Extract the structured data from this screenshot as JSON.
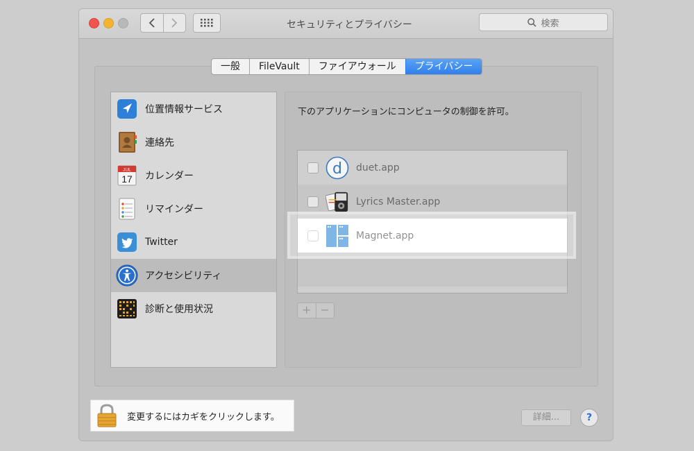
{
  "window": {
    "title": "セキュリティとプライバシー",
    "search_placeholder": "検索"
  },
  "tabs": [
    {
      "label": "一般",
      "active": false
    },
    {
      "label": "FileVault",
      "active": false
    },
    {
      "label": "ファイアウォール",
      "active": false
    },
    {
      "label": "プライバシー",
      "active": true
    }
  ],
  "sidebar": {
    "items": [
      {
        "label": "位置情報サービス",
        "icon": "location-arrow-icon",
        "selected": false
      },
      {
        "label": "連絡先",
        "icon": "contacts-book-icon",
        "selected": false
      },
      {
        "label": "カレンダー",
        "icon": "calendar-icon",
        "calendar_month": "JUL",
        "calendar_day": "17",
        "selected": false
      },
      {
        "label": "リマインダー",
        "icon": "reminders-icon",
        "selected": false
      },
      {
        "label": "Twitter",
        "icon": "twitter-bird-icon",
        "selected": false
      },
      {
        "label": "アクセシビリティ",
        "icon": "accessibility-icon",
        "selected": true
      },
      {
        "label": "診断と使用状況",
        "icon": "diagnostics-grid-icon",
        "selected": false
      }
    ]
  },
  "content": {
    "description": "下のアプリケーションにコンピュータの制御を許可。",
    "apps": [
      {
        "name": "duet.app",
        "icon": "duet-app-icon",
        "icon_letter": "d",
        "checked": false,
        "highlighted": false
      },
      {
        "name": "Lyrics Master.app",
        "icon": "lyrics-master-app-icon",
        "checked": false,
        "highlighted": false
      },
      {
        "name": "Magnet.app",
        "icon": "magnet-app-icon",
        "checked": false,
        "highlighted": true
      }
    ],
    "add_label": "+",
    "remove_label": "−"
  },
  "footer": {
    "lock_text": "変更するにはカギをクリックします。",
    "details_label": "詳細...",
    "help_label": "?"
  },
  "colors": {
    "accent": "#2f80ec",
    "close": "#f0544f",
    "minimize": "#f4b42f"
  }
}
